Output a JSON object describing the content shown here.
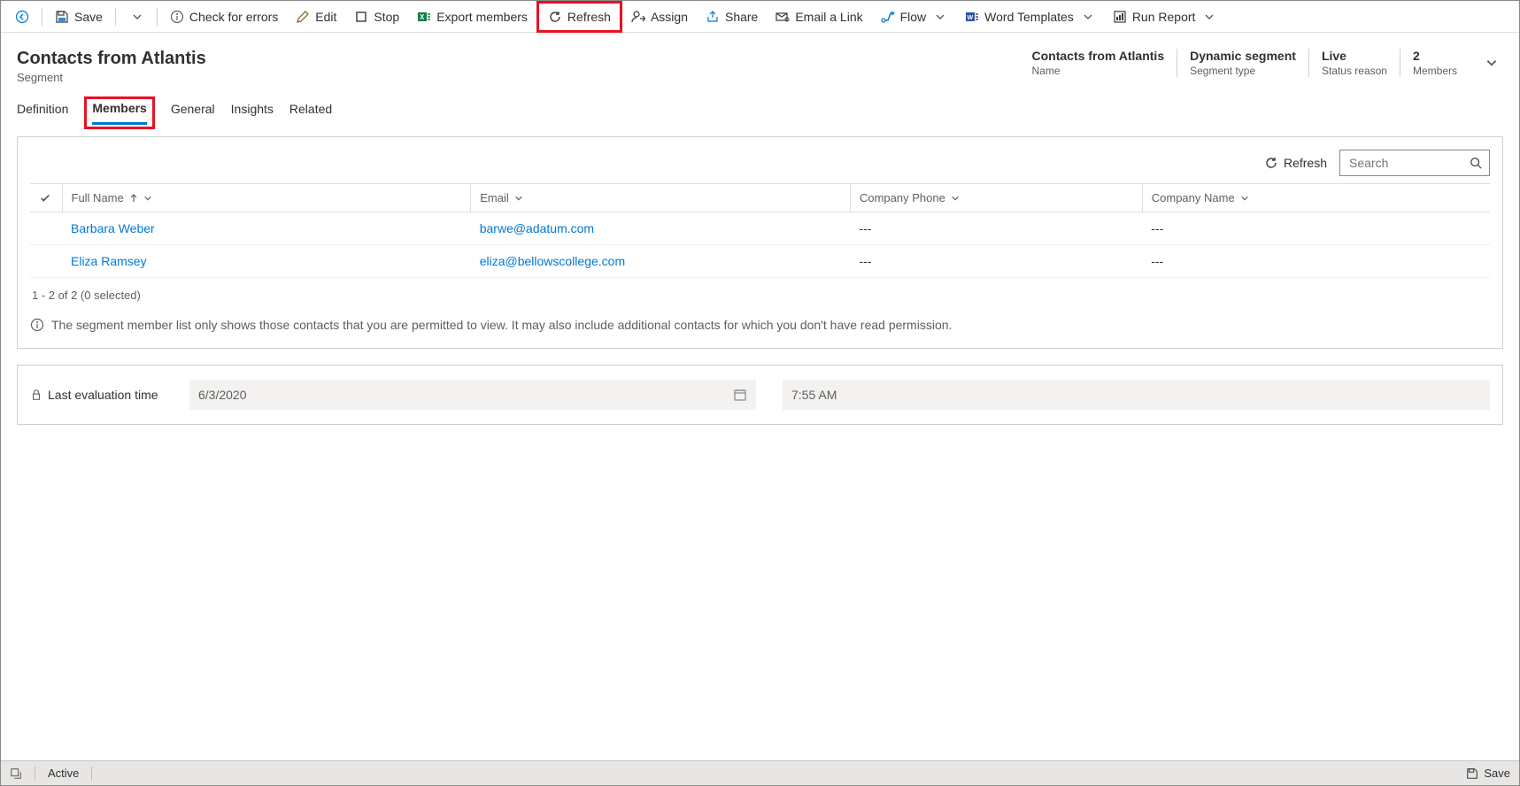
{
  "toolbar": {
    "save": "Save",
    "check_errors": "Check for errors",
    "edit": "Edit",
    "stop": "Stop",
    "export_members": "Export members",
    "refresh": "Refresh",
    "assign": "Assign",
    "share": "Share",
    "email_link": "Email a Link",
    "flow": "Flow",
    "word_templates": "Word Templates",
    "run_report": "Run Report"
  },
  "header": {
    "title": "Contacts from Atlantis",
    "subtitle": "Segment"
  },
  "summary": [
    {
      "value": "Contacts from Atlantis",
      "label": "Name"
    },
    {
      "value": "Dynamic segment",
      "label": "Segment type"
    },
    {
      "value": "Live",
      "label": "Status reason"
    },
    {
      "value": "2",
      "label": "Members"
    }
  ],
  "tabs": {
    "definition": "Definition",
    "members": "Members",
    "general": "General",
    "insights": "Insights",
    "related": "Related"
  },
  "grid_toolbar": {
    "refresh": "Refresh",
    "search_placeholder": "Search"
  },
  "columns": {
    "full_name": "Full Name",
    "email": "Email",
    "company_phone": "Company Phone",
    "company_name": "Company Name"
  },
  "rows": [
    {
      "full_name": "Barbara Weber",
      "email": "barwe@adatum.com",
      "company_phone": "---",
      "company_name": "---"
    },
    {
      "full_name": "Eliza Ramsey",
      "email": "eliza@bellowscollege.com",
      "company_phone": "---",
      "company_name": "---"
    }
  ],
  "grid_footer": "1 - 2 of 2 (0 selected)",
  "info_note": "The segment member list only shows those contacts that you are permitted to view. It may also include additional contacts for which you don't have read permission.",
  "evaluation": {
    "label": "Last evaluation time",
    "date": "6/3/2020",
    "time": "7:55 AM"
  },
  "statusbar": {
    "state": "Active",
    "save": "Save"
  }
}
